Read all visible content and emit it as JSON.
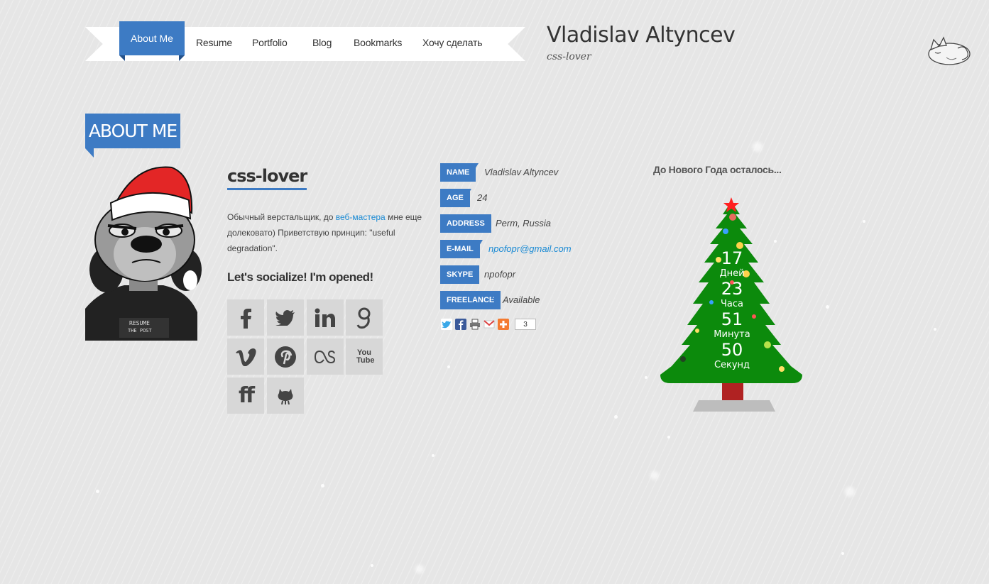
{
  "nav": {
    "items": [
      {
        "label": "About Me",
        "active": true
      },
      {
        "label": "Resume"
      },
      {
        "label": "Portfolio"
      },
      {
        "label": "Blog"
      },
      {
        "label": "Bookmarks"
      },
      {
        "label": "Хочу сделать"
      }
    ]
  },
  "header": {
    "name": "Vladislav Altyncev",
    "tagline": "css-lover",
    "logo_icon": "sleeping-cat-icon"
  },
  "page": {
    "title": "ABOUT ME",
    "accent": "#3d7bc4"
  },
  "bio": {
    "title": "css-lover",
    "text_before": "Обычный верстальщик, до ",
    "link_text": "веб-мастера",
    "text_after": " мне еще долековато) Приветствую принцип: \"useful degradation\".",
    "social_title": "Let's socialize! I'm opened!"
  },
  "social": [
    {
      "icon": "facebook-icon"
    },
    {
      "icon": "twitter-icon"
    },
    {
      "icon": "linkedin-icon"
    },
    {
      "icon": "google-icon"
    },
    {
      "icon": "vimeo-icon"
    },
    {
      "icon": "pinterest-icon"
    },
    {
      "icon": "lastfm-icon"
    },
    {
      "icon": "youtube-icon",
      "text": "You Tube"
    },
    {
      "icon": "friendfeed-icon",
      "text": "ff"
    },
    {
      "icon": "github-icon"
    }
  ],
  "info": [
    {
      "label": "NAME",
      "value": "Vladislav Altyncev"
    },
    {
      "label": "AGE",
      "value": "24"
    },
    {
      "label": "ADDRESS",
      "value": "Perm, Russia"
    },
    {
      "label": "E-MAIL",
      "value": "npofopr@gmail.com",
      "link": true
    },
    {
      "label": "SKYPE",
      "value": "npofopr"
    },
    {
      "label": "FREELANCE",
      "value": "Available"
    }
  ],
  "share": {
    "icons": [
      "twitter-icon",
      "facebook-icon",
      "print-icon",
      "gmail-icon",
      "plus-icon"
    ],
    "count": "3"
  },
  "countdown": {
    "title": "До Нового Года осталось...",
    "days": "17",
    "days_label": "Дней",
    "hours": "23",
    "hours_label": "Часа",
    "minutes": "51",
    "minutes_label": "Минута",
    "seconds": "50",
    "seconds_label": "Секунд",
    "tree_color": "#0c8a0c"
  }
}
